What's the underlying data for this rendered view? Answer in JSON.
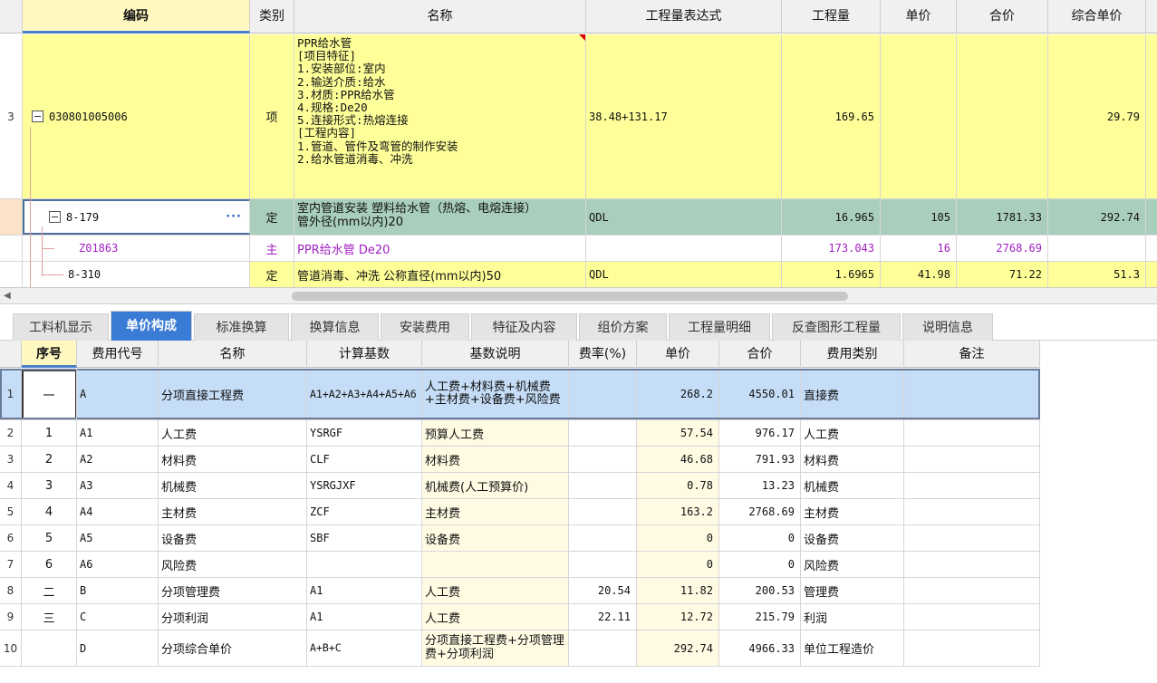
{
  "top_grid": {
    "headers": [
      "编码",
      "类别",
      "名称",
      "工程量表达式",
      "工程量",
      "单价",
      "合价",
      "综合单价"
    ],
    "rows": [
      {
        "row_num": "3",
        "code": "030801005006",
        "type": "项",
        "name_lines": [
          "PPR给水管",
          "[项目特征]",
          "1.安装部位:室内",
          "2.输送介质:给水",
          "3.材质:PPR给水管",
          "4.规格:De20",
          "5.连接形式:热熔连接",
          "[工程内容]",
          "1.管道、管件及弯管的制作安装",
          "2.给水管道消毒、冲洗"
        ],
        "expression": "38.48+131.17",
        "quantity": "169.65",
        "unit_price": "",
        "total": "",
        "composite_price": "29.79"
      },
      {
        "row_num": "",
        "code": "8-179",
        "ellipsis": "···",
        "type": "定",
        "name_lines": [
          "室内管道安装 塑料给水管（热熔、电熔连接）",
          "管外径(mm以内)20"
        ],
        "expression": "QDL",
        "quantity": "16.965",
        "unit_price": "105",
        "total": "1781.33",
        "composite_price": "292.74"
      },
      {
        "row_num": "",
        "code": "Z01863",
        "type": "主",
        "name": "PPR给水管 De20",
        "expression": "",
        "quantity": "173.043",
        "unit_price": "16",
        "total": "2768.69",
        "composite_price": ""
      },
      {
        "row_num": "",
        "code": "8-310",
        "type": "定",
        "name": "管道消毒、冲洗 公称直径(mm以内)50",
        "expression": "QDL",
        "quantity": "1.6965",
        "unit_price": "41.98",
        "total": "71.22",
        "composite_price": "51.3"
      }
    ]
  },
  "scrollbar": {
    "left_arrow": "◀"
  },
  "tabs": [
    {
      "label": "工料机显示",
      "active": false
    },
    {
      "label": "单价构成",
      "active": true
    },
    {
      "label": "标准换算",
      "active": false
    },
    {
      "label": "换算信息",
      "active": false
    },
    {
      "label": "安装费用",
      "active": false
    },
    {
      "label": "特征及内容",
      "active": false
    },
    {
      "label": "组价方案",
      "active": false
    },
    {
      "label": "工程量明细",
      "active": false
    },
    {
      "label": "反查图形工程量",
      "active": false
    },
    {
      "label": "说明信息",
      "active": false
    }
  ],
  "bottom_grid": {
    "headers": [
      "序号",
      "费用代号",
      "名称",
      "计算基数",
      "基数说明",
      "费率(%)",
      "单价",
      "合价",
      "费用类别",
      "备注"
    ],
    "rows": [
      {
        "row_num": "1",
        "seq": "一",
        "code": "A",
        "name": "分项直接工程费",
        "base": "A1+A2+A3+A4+A5+A6",
        "base_desc": "人工费+材料费+机械费+主材费+设备费+风险费",
        "rate": "",
        "unit_price": "268.2",
        "total": "4550.01",
        "category": "直接费",
        "remark": ""
      },
      {
        "row_num": "2",
        "seq": "1",
        "code": "A1",
        "name": "人工费",
        "base": "YSRGF",
        "base_desc": "预算人工费",
        "rate": "",
        "unit_price": "57.54",
        "total": "976.17",
        "category": "人工费",
        "remark": ""
      },
      {
        "row_num": "3",
        "seq": "2",
        "code": "A2",
        "name": "材料费",
        "base": "CLF",
        "base_desc": "材料费",
        "rate": "",
        "unit_price": "46.68",
        "total": "791.93",
        "category": "材料费",
        "remark": ""
      },
      {
        "row_num": "4",
        "seq": "3",
        "code": "A3",
        "name": "机械费",
        "base": "YSRGJXF",
        "base_desc": "机械费(人工预算价)",
        "rate": "",
        "unit_price": "0.78",
        "total": "13.23",
        "category": "机械费",
        "remark": ""
      },
      {
        "row_num": "5",
        "seq": "4",
        "code": "A4",
        "name": "主材费",
        "base": "ZCF",
        "base_desc": "主材费",
        "rate": "",
        "unit_price": "163.2",
        "total": "2768.69",
        "category": "主材费",
        "remark": ""
      },
      {
        "row_num": "6",
        "seq": "5",
        "code": "A5",
        "name": "设备费",
        "base": "SBF",
        "base_desc": "设备费",
        "rate": "",
        "unit_price": "0",
        "total": "0",
        "category": "设备费",
        "remark": ""
      },
      {
        "row_num": "7",
        "seq": "6",
        "code": "A6",
        "name": "风险费",
        "base": "",
        "base_desc": "",
        "rate": "",
        "unit_price": "0",
        "total": "0",
        "category": "风险费",
        "remark": ""
      },
      {
        "row_num": "8",
        "seq": "二",
        "code": "B",
        "name": "分项管理费",
        "base": "A1",
        "base_desc": "人工费",
        "rate": "20.54",
        "unit_price": "11.82",
        "total": "200.53",
        "category": "管理费",
        "remark": ""
      },
      {
        "row_num": "9",
        "seq": "三",
        "code": "C",
        "name": "分项利润",
        "base": "A1",
        "base_desc": "人工费",
        "rate": "22.11",
        "unit_price": "12.72",
        "total": "215.79",
        "category": "利润",
        "remark": ""
      },
      {
        "row_num": "10",
        "seq": "",
        "code": "D",
        "name": "分项综合单价",
        "base": "A+B+C",
        "base_desc": "分项直接工程费+分项管理费+分项利润",
        "rate": "",
        "unit_price": "292.74",
        "total": "4966.33",
        "category": "单位工程造价",
        "remark": ""
      }
    ]
  }
}
